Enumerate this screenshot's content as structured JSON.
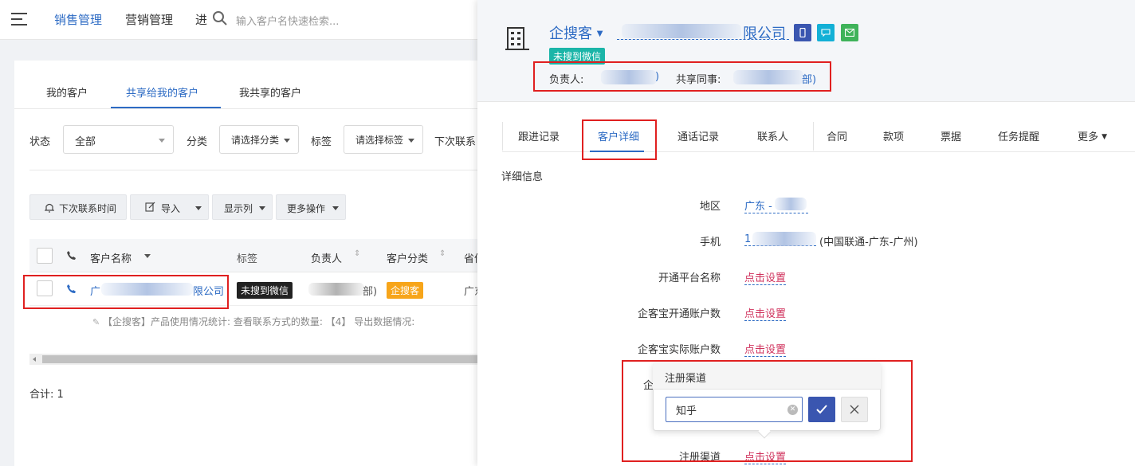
{
  "topbar": {
    "nav": [
      "销售管理",
      "营销管理",
      "进"
    ],
    "search_placeholder": "输入客户名快速检索..."
  },
  "left": {
    "tabs": [
      "我的客户",
      "共享给我的客户",
      "我共享的客户"
    ],
    "filters": {
      "status_label": "状态",
      "status_value": "全部",
      "category_label": "分类",
      "category_value": "请选择分类",
      "tag_label": "标签",
      "tag_value": "请选择标签",
      "next_contact_label": "下次联系"
    },
    "toolbar": [
      "下次联系时间",
      "导入",
      "显示列",
      "更多操作"
    ],
    "columns": [
      "客户名称",
      "标签",
      "负责人",
      "客户分类",
      "省份"
    ],
    "row": {
      "name_prefix": "广",
      "name_suffix": "限公司",
      "tag": "未搜到微信",
      "owner_suffix": "部)",
      "category": "企搜客",
      "province": "广东"
    },
    "stats": "【企搜客】产品使用情况统计:  查看联系方式的数量: 【4】 导出数据情况:",
    "total": "合计: 1"
  },
  "right": {
    "source": "企搜客",
    "company_suffix": "限公司",
    "wechat_tag": "未搜到微信",
    "owner_label": "负责人:",
    "owner_suffix": ")",
    "colleague_label": "共享同事:",
    "colleague_suffix": "部)",
    "tabs": [
      "跟进记录",
      "客户详细",
      "通话记录",
      "联系人",
      "合同",
      "款项",
      "票据",
      "任务提醒",
      "更多"
    ],
    "section_title": "详细信息",
    "fields": {
      "region_label": "地区",
      "region_value": "广东 -",
      "phone_label": "手机",
      "phone_prefix": "1",
      "phone_carrier": "(中国联通-广东-广州)",
      "platform_label": "开通平台名称",
      "platform_value": "点击设置",
      "open_accounts_label": "企客宝开通账户数",
      "open_accounts_value": "点击设置",
      "actual_accounts_label": "企客宝实际账户数",
      "actual_accounts_value": "点击设置",
      "hidden_label_fragment": "企",
      "channel_label": "注册渠道",
      "channel_value": "点击设置"
    },
    "popover": {
      "title": "注册渠道",
      "input_value": "知乎"
    }
  },
  "colors": {
    "accent": "#2d6bc4",
    "highlight_red": "#e02020",
    "link_red": "#d0325d",
    "wechat_tag": "#1bb5a8",
    "category_tag": "#f7a51a"
  }
}
